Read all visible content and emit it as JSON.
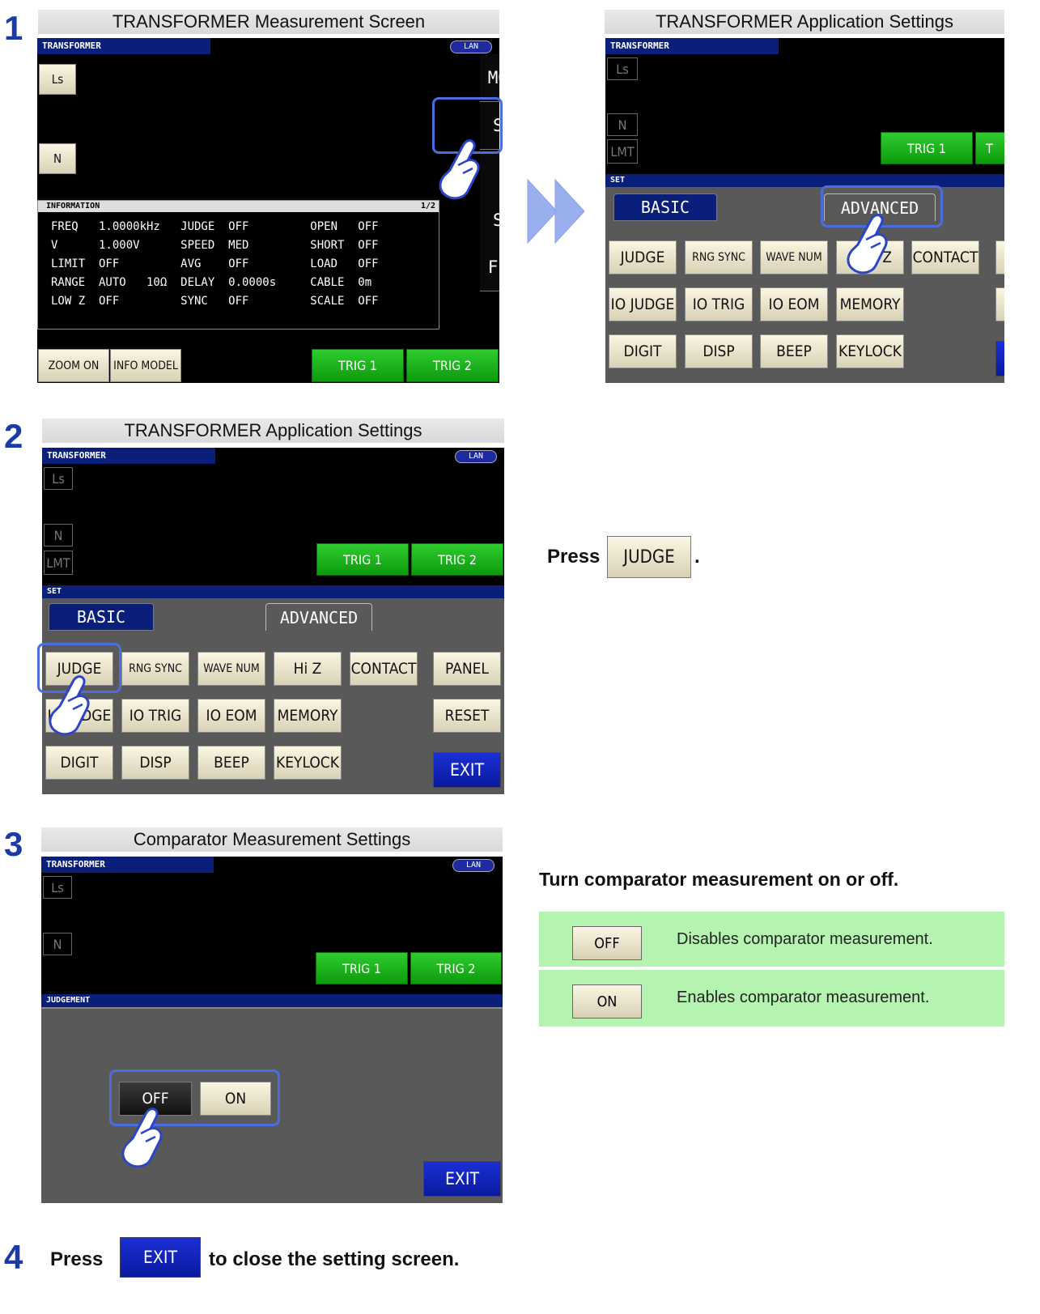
{
  "steps": {
    "s1": "1",
    "s2": "2",
    "s3": "3",
    "s4": "4"
  },
  "captions": {
    "measure": "TRANSFORMER Measurement Screen",
    "appset_right": "TRANSFORMER Application Settings",
    "appset": "TRANSFORMER Application Settings",
    "comparator": "Comparator Measurement Settings"
  },
  "screen": {
    "title": "TRANSFORMER",
    "lan": "LAN",
    "ls": "Ls",
    "n": "N",
    "lmt": "LMT",
    "set_bar": "SET",
    "judgement_bar": "JUDGEMENT"
  },
  "measure": {
    "side": [
      "MODE",
      "SET",
      "",
      "SYS",
      "FILE"
    ],
    "info_title": "INFORMATION",
    "info_page": "1/2",
    "info_rows": [
      "FREQ   1.0000kHz   JUDGE  OFF         OPEN   OFF",
      "V      1.000V      SPEED  MED         SHORT  OFF",
      "LIMIT  OFF         AVG    OFF         LOAD   OFF",
      "RANGE  AUTO   10Ω  DELAY  0.0000s     CABLE  0m",
      "LOW Z  OFF         SYNC   OFF         SCALE  OFF"
    ],
    "zoom": "ZOOM ON",
    "info_model": "INFO MODEL",
    "trig1": "TRIG 1",
    "trig2": "TRIG 2"
  },
  "settings": {
    "tab_basic": "BASIC",
    "tab_advanced": "ADVANCED",
    "row1": [
      "JUDGE",
      "RNG SYNC",
      "WAVE NUM",
      "Hi Z",
      "CONTACT"
    ],
    "row2": [
      "IO JUDGE",
      "IO TRIG",
      "IO EOM",
      "MEMORY"
    ],
    "row3": [
      "DIGIT",
      "DISP",
      "BEEP",
      "KEYLOCK"
    ],
    "panel": "PANEL",
    "reset": "RESET",
    "exit": "EXIT",
    "trig1": "TRIG 1",
    "trig2": "TRIG 2",
    "right_trig2_partial": "T",
    "right_row1_z": "Z"
  },
  "comparator_screen": {
    "off": "OFF",
    "on": "ON",
    "exit": "EXIT"
  },
  "instructions": {
    "press": "Press",
    "judge_btn": "JUDGE",
    "period": ".",
    "turn": "Turn comparator measurement on or off.",
    "off_btn": "OFF",
    "off_desc": "Disables comparator measurement.",
    "on_btn": "ON",
    "on_desc": "Enables comparator measurement.",
    "press4": "Press",
    "exit_btn": "EXIT",
    "close": "to close the setting screen."
  },
  "colors": {
    "step_blue": "#1a3aa8",
    "trig_green": "#13a813",
    "highlight": "#4a6ee0",
    "table_green": "#b5f4b0"
  }
}
